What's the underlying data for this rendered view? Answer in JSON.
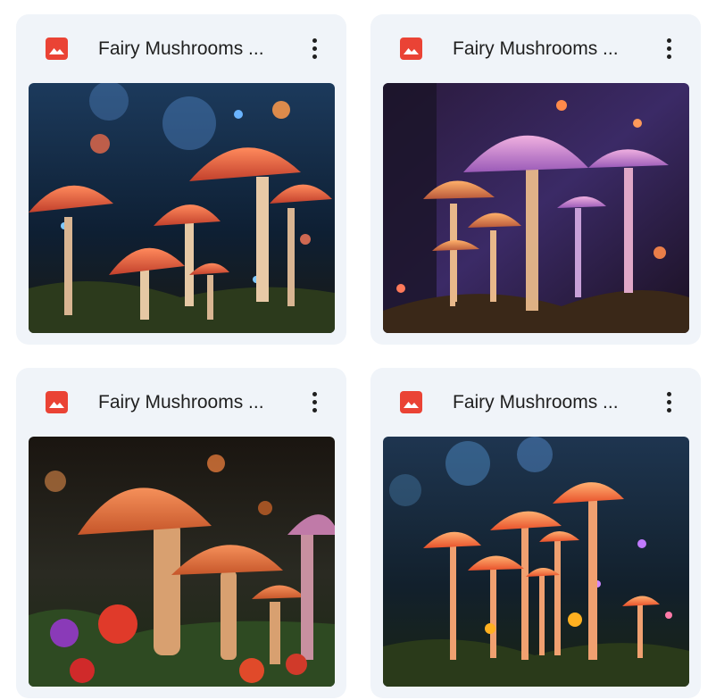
{
  "files": [
    {
      "title": "Fairy Mushrooms ...",
      "icon": "image-file-icon",
      "menu_icon": "more-vert-icon",
      "icon_color": "#ea4335"
    },
    {
      "title": "Fairy Mushrooms ...",
      "icon": "image-file-icon",
      "menu_icon": "more-vert-icon",
      "icon_color": "#ea4335"
    },
    {
      "title": "Fairy Mushrooms ...",
      "icon": "image-file-icon",
      "menu_icon": "more-vert-icon",
      "icon_color": "#ea4335"
    },
    {
      "title": "Fairy Mushrooms ...",
      "icon": "image-file-icon",
      "menu_icon": "more-vert-icon",
      "icon_color": "#ea4335"
    }
  ],
  "colors": {
    "card_background": "#f0f4f9",
    "text": "#1f1f1f"
  }
}
